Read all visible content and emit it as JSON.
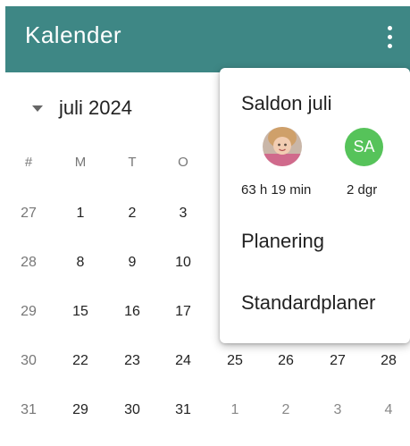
{
  "app": {
    "title": "Kalender"
  },
  "calendar": {
    "month_label": "juli 2024",
    "headers": [
      "#",
      "M",
      "T",
      "O"
    ],
    "rows": [
      {
        "week": "27",
        "days": [
          "1",
          "2",
          "3"
        ]
      },
      {
        "week": "28",
        "days": [
          "8",
          "9",
          "10"
        ]
      },
      {
        "week": "29",
        "days": [
          "15",
          "16",
          "17"
        ]
      },
      {
        "week": "30",
        "days": [
          "22",
          "23",
          "24",
          "25",
          "26",
          "27",
          "28"
        ]
      },
      {
        "week": "31",
        "days": [
          "29",
          "30",
          "31",
          "1",
          "2",
          "3",
          "4"
        ]
      }
    ]
  },
  "popup": {
    "title": "Saldon juli",
    "user_photo_value": "63 h 19 min",
    "user_sa_initials": "SA",
    "user_sa_value": "2 dgr",
    "items": [
      "Planering",
      "Standardplaner"
    ]
  },
  "colors": {
    "header_bg": "#3e8785",
    "sa_avatar": "#56c35a"
  }
}
